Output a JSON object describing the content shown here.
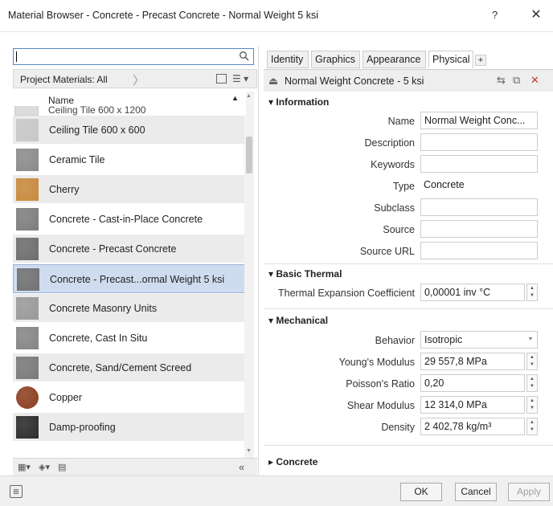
{
  "window": {
    "title": "Material Browser - Concrete - Precast Concrete - Normal Weight 5 ksi",
    "help_label": "?",
    "close_label": "✕"
  },
  "left": {
    "search_placeholder": "",
    "library_label": "Project Materials: All",
    "column_header": "Name",
    "partial_row": "Ceiling Tile 600 x 1200",
    "materials": [
      {
        "label": "Ceiling Tile 600 x 600",
        "swatch": "#c8c8c8"
      },
      {
        "label": "Ceramic Tile",
        "swatch": "#8a8a8a"
      },
      {
        "label": "Cherry",
        "swatch": "#c98a3e"
      },
      {
        "label": "Concrete - Cast-in-Place Concrete",
        "swatch": "#7d7d7d"
      },
      {
        "label": "Concrete - Precast Concrete",
        "swatch": "#6e6e6e"
      },
      {
        "label": "Concrete - Precast...ormal Weight 5 ksi",
        "swatch": "#737373"
      },
      {
        "label": "Concrete Masonry Units",
        "swatch": "#9a9a9a"
      },
      {
        "label": "Concrete, Cast In Situ",
        "swatch": "#858585"
      },
      {
        "label": "Concrete, Sand/Cement Screed",
        "swatch": "#7a7a7a"
      },
      {
        "label": "Copper",
        "swatch": "#8c3f1f"
      },
      {
        "label": "Damp-proofing",
        "swatch": "#2c2c2c"
      }
    ],
    "selected_index": 5
  },
  "right": {
    "tabs": [
      "Identity",
      "Graphics",
      "Appearance",
      "Physical"
    ],
    "active_tab": "Physical",
    "add_tab_label": "+",
    "asset_name": "Normal Weight Concrete - 5 ksi",
    "sections": {
      "information": "Information",
      "basic_thermal": "Basic Thermal",
      "mechanical": "Mechanical",
      "concrete": "Concrete"
    },
    "information": {
      "name_label": "Name",
      "name_value": "Normal Weight Conc...",
      "description_label": "Description",
      "description_value": "",
      "keywords_label": "Keywords",
      "keywords_value": "",
      "type_label": "Type",
      "type_value": "Concrete",
      "subclass_label": "Subclass",
      "subclass_value": "",
      "source_label": "Source",
      "source_value": "",
      "source_url_label": "Source URL",
      "source_url_value": ""
    },
    "thermal": {
      "expansion_label": "Thermal Expansion Coefficient",
      "expansion_value": "0,00001 inv °C"
    },
    "mechanical": {
      "behavior_label": "Behavior",
      "behavior_value": "Isotropic",
      "youngs_label": "Young's Modulus",
      "youngs_value": "29 557,8 MPa",
      "poisson_label": "Poisson's Ratio",
      "poisson_value": "0,20",
      "shear_label": "Shear Modulus",
      "shear_value": "12 314,0 MPa",
      "density_label": "Density",
      "density_value": "2 402,78 kg/m³"
    }
  },
  "buttons": {
    "ok": "OK",
    "cancel": "Cancel",
    "apply": "Apply"
  }
}
